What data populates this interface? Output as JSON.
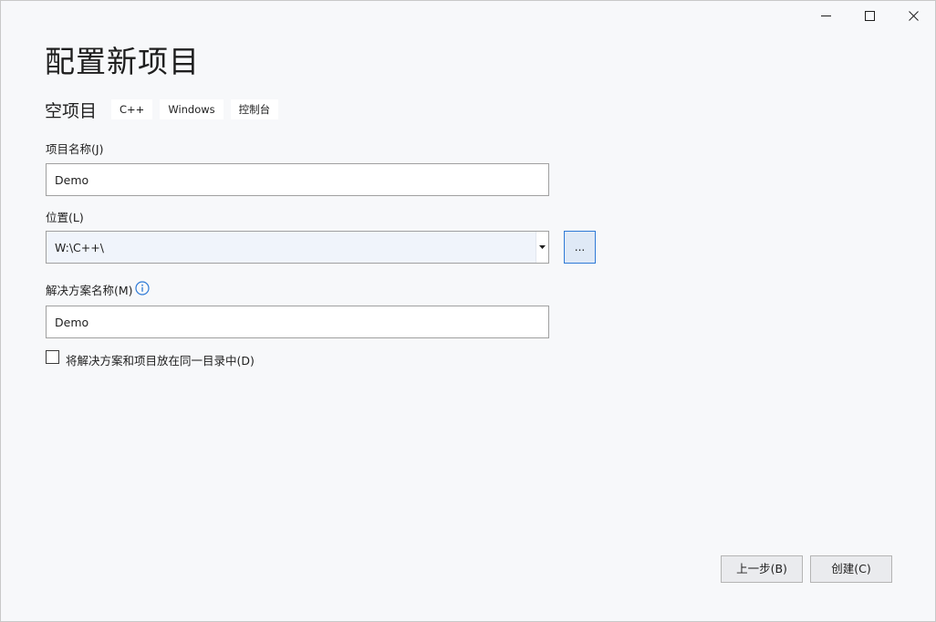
{
  "window": {
    "title": "配置新项目",
    "caption_buttons": [
      "minimize-icon",
      "maximize-icon",
      "close-icon"
    ]
  },
  "template": {
    "name": "空项目",
    "tags": [
      "C++",
      "Windows",
      "控制台"
    ]
  },
  "project_name": {
    "label": "项目名称(J)",
    "value": "Demo"
  },
  "location": {
    "label": "位置(L)",
    "value": "W:\\C++\\",
    "browse_label": "..."
  },
  "solution_name": {
    "label": "解决方案名称(M)",
    "value": "Demo",
    "info_icon": "info-icon"
  },
  "same_directory": {
    "label": "将解决方案和项目放在同一目录中(D)",
    "checked": false
  },
  "buttons": {
    "back": "上一步(B)",
    "create": "创建(C)"
  },
  "colors": {
    "accent": "#2f7ad6",
    "background": "#f7f8fa"
  }
}
